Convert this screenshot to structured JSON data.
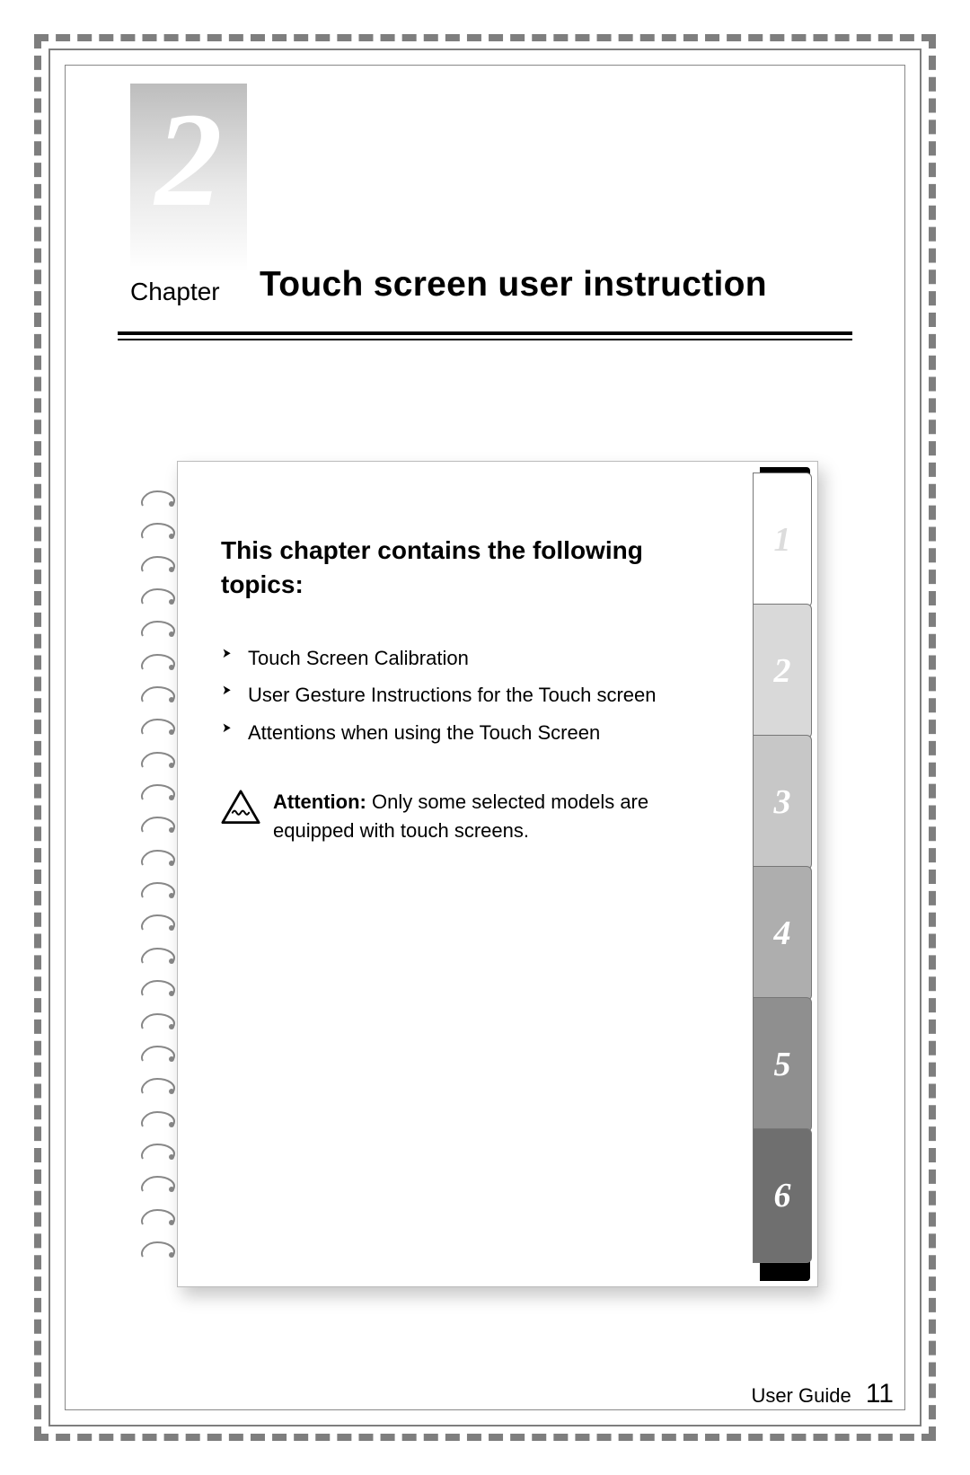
{
  "chapter_number": "2",
  "chapter_label": "Chapter",
  "chapter_title": "Touch screen user instruction",
  "notebook": {
    "lead": "This chapter contains the following topics:",
    "topics": [
      "Touch Screen Calibration",
      "User Gesture Instructions for the Touch screen",
      "Attentions when using the Touch Screen"
    ],
    "attention_label": "Attention:",
    "attention_text": " Only some selected models are equipped with touch screens."
  },
  "tabs": [
    "1",
    "2",
    "3",
    "4",
    "5",
    "6"
  ],
  "footer_label": "User Guide",
  "page_number": "11"
}
